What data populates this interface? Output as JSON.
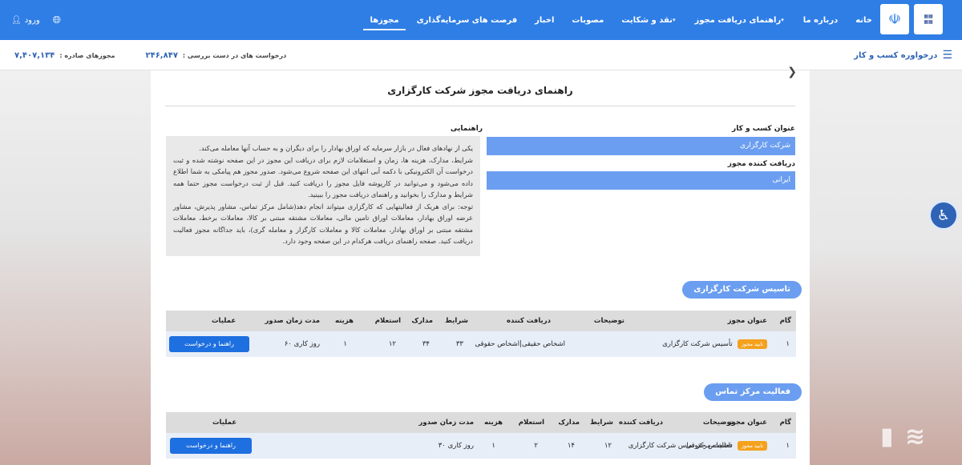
{
  "nav": {
    "items": [
      "خانه",
      "درباره ما",
      "راهنمای دریافت مجوز",
      "نقد و شکایت",
      "مصوبات",
      "اخبار",
      "فرصت های سرمایه‌گذاری",
      "مجوزها"
    ],
    "login_label": "ورود"
  },
  "subbar": {
    "request_label": "درخواوره کسب و کار",
    "pending_label": "درخواست های در دست بررسی :",
    "pending_value": "۲۴۶,۸۴۷",
    "issued_label": "مجوزهای صادره :",
    "issued_value": "۷,۴۰۷,۱۳۴"
  },
  "page": {
    "title": "راهنمای دریافت مجوز شرکت کارگزاری",
    "business_title_label": "عنوان کسب و کار",
    "business_title_value": "شرکت کارگزاری",
    "receiver_label": "دریافت کننده مجوز",
    "receiver_value": "ایرانی",
    "guide_label": "راهنمایی",
    "guide_paragraphs": [
      "یکی از نهادهای فعال در بازار سرمایه که اوراق بهادار را برای دیگران و به حساب آنها معامله می‌کند.",
      "شرایط، مدارک، هزینه ها، زمان و استعلامات لازم برای دریافت این مجوز در این صفحه نوشته شده و ثبت درخواست آن الکترونیکی با دکمه آبی انتهای این صفحه شروع می‌شود. صدور مجوز هم پیامکی به شما اطلاع داده می‌شود و می‌توانید در کارپوشه فایل مجوز را دریافت کنید. قبل از ثبت درخواست مجوز حتما همه شرایط و مدارک را بخوانید و راهنمای دریافت مجوز را ببینید.",
      "توجه: برای هریک از فعالیتهایی که کارگزاری میتواند انجام دهد(شامل مرکز تماس، مشاور پذیرش، مشاور عرضه اوراق بهادار، معاملات اوراق تامین مالی، معاملات مشتقه مبتنی بر کالا، معاملات برخط، معاملات مشتقه مبتنی بر اوراق بهادار، معاملات کالا و معاملات کارگزار و معامله گری)، باید جداگانه مجوز فعالیت دریافت کنید. صفحه راهنمای دریافت هرکدام در این صفحه وجود دارد."
    ]
  },
  "headers": {
    "step": "گام",
    "title": "عنوان مجوز",
    "desc": "توضیحات",
    "receiver": "دریافت کننده",
    "conditions": "شرایط",
    "docs": "مدارک",
    "inquiry": "استعلام",
    "cost": "هزینه",
    "time": "مدت زمان صدور",
    "ops": "عملیات"
  },
  "sections": [
    {
      "title": "تاسیس شرکت کارگزاری",
      "row": {
        "step": "۱",
        "title": "تأسیس شرکت کارگزاری",
        "badge": "تایید مجوز",
        "receiver": "اشخاص حقیقی|اشخاص حقوقی",
        "conditions": "۳۳",
        "docs": "۳۴",
        "inquiry": "۱۲",
        "cost": "۱",
        "time": "۶۰ روز کاری",
        "button": "راهنما و درخواست"
      }
    },
    {
      "title": "فعالیت مرکز تماس",
      "row": {
        "step": "۱",
        "title": "فعالیت مرکز تماس شرکت کارگزاری",
        "badge": "تایید مجوز",
        "receiver": "اشخاص حقوقی",
        "conditions": "۱۲",
        "docs": "۱۴",
        "inquiry": "۲",
        "cost": "۱",
        "time": "۳۰ روز کاری",
        "button": "راهنما و درخواست"
      }
    }
  ],
  "colors": {
    "nav_bg": "#2f7ee6",
    "field_bg": "#6b9ef0",
    "badge": "#f4a11d",
    "button": "#1e6fe0"
  },
  "icons": {
    "menu": "menu-icon",
    "globe": "globe-icon",
    "user": "user-icon",
    "back": "back-arrow-icon",
    "accessibility": "accessibility-icon"
  }
}
